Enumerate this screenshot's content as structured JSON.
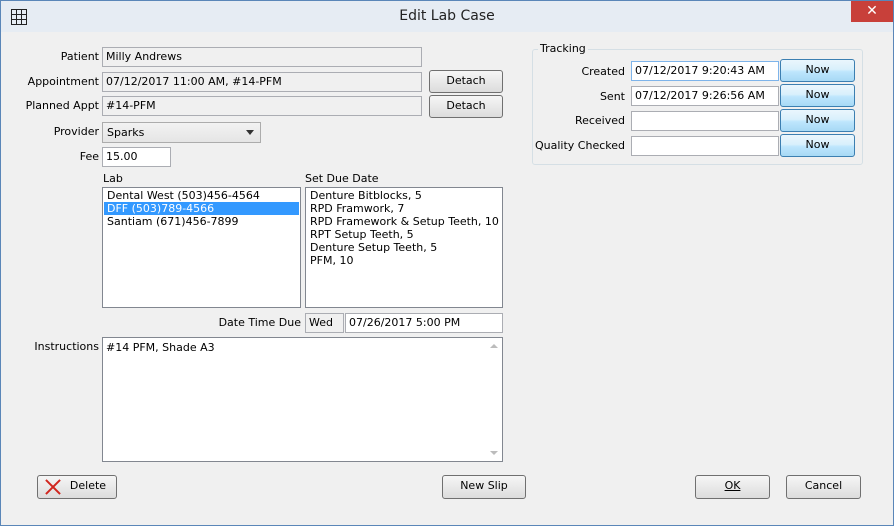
{
  "window": {
    "title": "Edit Lab Case",
    "close_glyph": "✕",
    "app_icon": "grid-icon"
  },
  "form": {
    "patient_label": "Patient",
    "patient_value": "Milly Andrews",
    "appointment_label": "Appointment",
    "appointment_value": "07/12/2017 11:00 AM, #14-PFM",
    "planned_label": "Planned Appt",
    "planned_value": "#14-PFM",
    "detach_label": "Detach",
    "provider_label": "Provider",
    "provider_value": "Sparks",
    "fee_label": "Fee",
    "fee_value": "15.00"
  },
  "lab": {
    "label": "Lab",
    "items": [
      {
        "text": "Dental West (503)456-4564",
        "selected": false
      },
      {
        "text": "DFF (503)789-4566",
        "selected": true
      },
      {
        "text": "Santiam (671)456-7899",
        "selected": false
      }
    ]
  },
  "due": {
    "label": "Set Due Date",
    "items": [
      "Denture Bitblocks, 5",
      "RPD Framwork, 7",
      "RPD Framework & Setup Teeth, 10",
      "RPT Setup Teeth, 5",
      "Denture Setup Teeth, 5",
      "PFM, 10"
    ],
    "datetime_label": "Date Time Due",
    "day_value": "Wed",
    "datetime_value": "07/26/2017 5:00 PM"
  },
  "instructions": {
    "label": "Instructions",
    "value": "#14 PFM, Shade A3"
  },
  "tracking": {
    "title": "Tracking",
    "now_label": "Now",
    "rows": [
      {
        "label": "Created",
        "value": "07/12/2017 9:20:43 AM"
      },
      {
        "label": "Sent",
        "value": "07/12/2017 9:26:56 AM"
      },
      {
        "label": "Received",
        "value": ""
      },
      {
        "label": "Quality Checked",
        "value": ""
      }
    ]
  },
  "buttons": {
    "delete": "Delete",
    "new_slip": "New Slip",
    "ok": "OK",
    "cancel": "Cancel"
  },
  "colors": {
    "selection": "#3399ff",
    "close": "#c8403a",
    "delete_icon": "#d1261f"
  }
}
